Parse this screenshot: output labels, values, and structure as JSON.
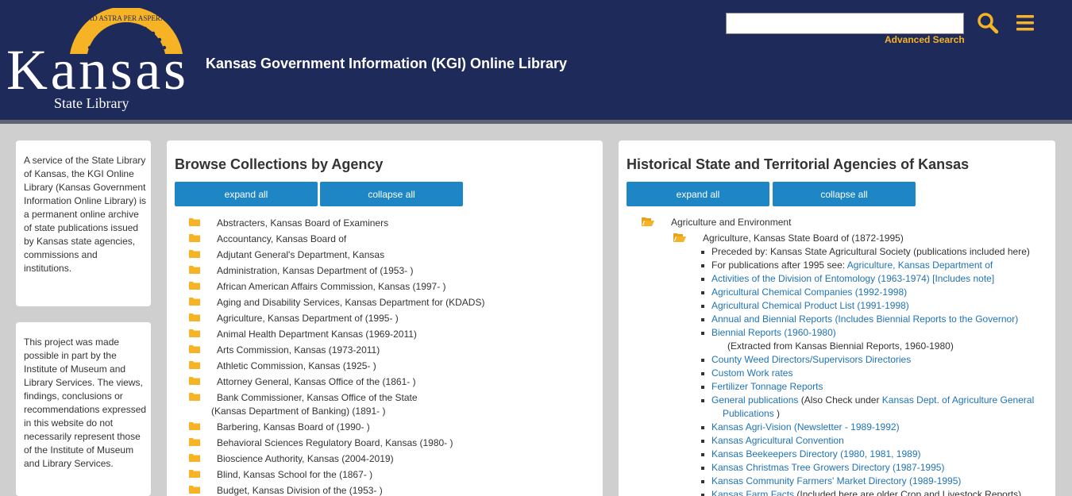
{
  "header": {
    "logo": {
      "motto": "AD ASTRA PER ASPERA",
      "wordmark": "Kansas",
      "subtitle": "State Library"
    },
    "title": "Kansas Government Information (KGI) Online Library",
    "search_placeholder": "",
    "search_value": "",
    "advanced_search": "Advanced Search",
    "search_icon": "search-icon",
    "menu_icon": "hamburger-menu-icon",
    "brand_color": "#1e2b5a",
    "accent_color": "#f5b325"
  },
  "sidebar": {
    "about_text": "A service of the State Library of Kansas, the KGI Online Library (Kansas Government Information Online Library) is a permanent online archive of state publications issued by Kansas state agencies, commissions and institutions.",
    "funding_text": "This project was made possible in part by the Institute of Museum and Library Services. The views, findings, conclusions or recommendations expressed in this website do not necessarily represent those of the Institute of Museum and Library Services."
  },
  "browse": {
    "heading": "Browse Collections by Agency",
    "expand_label": "expand all",
    "collapse_label": "collapse all",
    "button_color": "#1f86c6",
    "agencies": [
      "Abstracters, Kansas Board of Examiners",
      "Accountancy, Kansas Board of",
      "Adjutant General's Department, Kansas",
      "Administration, Kansas Department of (1953- )",
      "African American Affairs Commission, Kansas (1997- )",
      "Aging and Disability Services, Kansas Department for (KDADS)",
      "Agriculture, Kansas Department of (1995- )",
      "Animal Health Department Kansas (1969-2011)",
      "Arts Commission, Kansas (1973-2011)",
      "Athletic Commission, Kansas (1925- )",
      "Attorney General, Kansas Office of the (1861- )",
      "Bank Commissioner, Kansas Office of the State",
      "Barbering, Kansas Board of (1990- )",
      "Behavioral Sciences Regulatory Board, Kansas (1980- )",
      "Bioscience Authority, Kansas (2004-2019)",
      "Blind, Kansas School for the (1867- )",
      "Budget, Kansas Division of the (1953- )"
    ],
    "bank_second_line": "(Kansas Department of Banking) (1891- )"
  },
  "historical": {
    "heading": "Historical State and Territorial Agencies of Kansas",
    "expand_label": "expand all",
    "collapse_label": "collapse all",
    "category": "Agriculture and Environment",
    "subcategory": "Agriculture, Kansas State Board of (1872-1995)",
    "items": {
      "preceded": "Preceded by: Kansas State Agricultural Society (publications included here)",
      "after_prefix": "For publications after 1995 see: ",
      "after_link": "Agriculture, Kansas Department of",
      "entomology": "Activities of the Division of Entomology (1963-1974) [Includes note]",
      "chem_companies": "Agricultural Chemical Companies (1992-1998)",
      "chem_product": "Agricultural Chemical Product List (1991-1998)",
      "annual": "Annual and Biennial Reports (Includes Biennial Reports to the Governor)",
      "biennial": "Biennial Reports (1960-1980)",
      "biennial_note": "(Extracted from Kansas Biennial Reports, 1960-1980)",
      "weed": "County Weed Directors/Supervisors Directories",
      "custom": "Custom Work rates",
      "fertilizer": "Fertilizer Tonnage Reports",
      "general": "General publications",
      "general_mid": " (Also Check under ",
      "general_link": "Kansas Dept. of Agriculture General",
      "general_link2": "Publications",
      "general_end": " )",
      "agrivision": "Kansas Agri-Vision (Newsletter - 1989-1992)",
      "convention": "Kansas Agricultural Convention",
      "beekeepers": "Kansas Beekeepers Directory (1980, 1981, 1989)",
      "christmas": "Kansas Christmas Tree Growers Directory (1987-1995)",
      "farmers": "Kansas Community Farmers' Market Directory (1989-1995)",
      "farm_facts": "Kansas Farm Facts",
      "farm_facts_note": " (Included here are older Crop and Livestock Reports)"
    }
  }
}
